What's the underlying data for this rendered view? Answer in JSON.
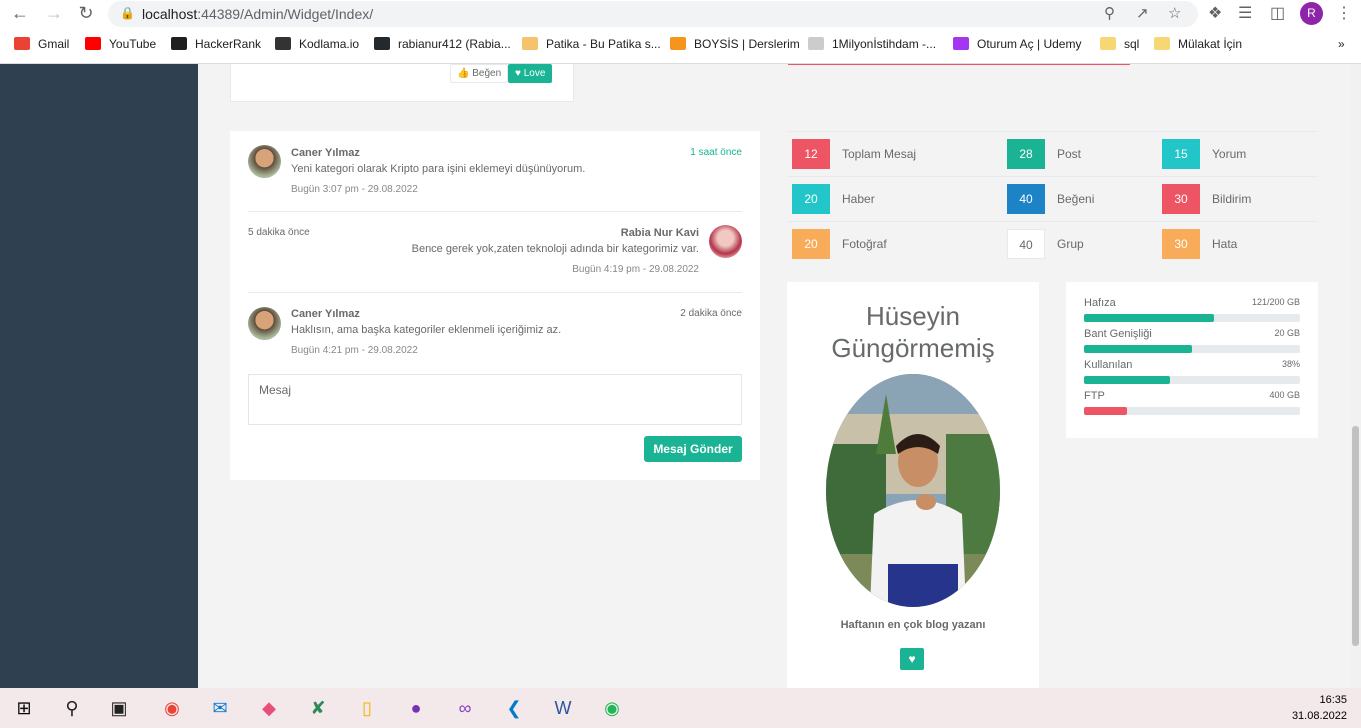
{
  "browser": {
    "url_host": "localhost",
    "url_path": ":44389/Admin/Widget/Index/",
    "profile_initial": "R",
    "bookmarks": [
      {
        "label": "Gmail",
        "color": "#ea4335"
      },
      {
        "label": "YouTube",
        "color": "#ff0000"
      },
      {
        "label": "HackerRank",
        "color": "#1f1f1f"
      },
      {
        "label": "Kodlama.io",
        "color": "#333333"
      },
      {
        "label": "rabianur412 (Rabia...",
        "color": "#24292e"
      },
      {
        "label": "Patika - Bu Patika s...",
        "color": "#f6c26b"
      },
      {
        "label": "BOYSİS | Derslerim",
        "color": "#f7941d"
      },
      {
        "label": "1Milyonİstihdam -...",
        "color": "#cccccc"
      },
      {
        "label": "Oturum Aç | Udemy",
        "color": "#a435f0"
      },
      {
        "label": "sql",
        "color": "#f7d774"
      },
      {
        "label": "Mülakat İçin",
        "color": "#f7d774"
      }
    ]
  },
  "top_widget": {
    "like_label": "Beğen",
    "love_label": "Love"
  },
  "chat": {
    "messages": [
      {
        "name": "Caner Yılmaz",
        "text": "Yeni kategori olarak Kripto para işini eklemeyi düşünüyorum.",
        "date": "Bugün 3:07 pm - 29.08.2022",
        "ago": "1 saat önce"
      },
      {
        "name": "Rabia Nur Kavi",
        "text": "Bence gerek yok,zaten teknoloji adında bir kategorimiz var.",
        "date": "Bugün 4:19 pm - 29.08.2022",
        "ago": "5 dakika önce"
      },
      {
        "name": "Caner Yılmaz",
        "text": "Haklısın, ama başka kategoriler eklenmeli içeriğimiz az.",
        "date": "Bugün 4:21 pm - 29.08.2022",
        "ago": "2 dakika önce"
      }
    ],
    "input_placeholder": "Mesaj",
    "send_label": "Mesaj Gönder"
  },
  "stats": [
    {
      "value": "12",
      "label": "Toplam Mesaj",
      "color": "#ed5565"
    },
    {
      "value": "28",
      "label": "Post",
      "color": "#1ab394"
    },
    {
      "value": "15",
      "label": "Yorum",
      "color": "#23c6c8"
    },
    {
      "value": "20",
      "label": "Haber",
      "color": "#23c6c8"
    },
    {
      "value": "40",
      "label": "Beğeni",
      "color": "#1c84c6"
    },
    {
      "value": "30",
      "label": "Bildirim",
      "color": "#ed5565"
    },
    {
      "value": "20",
      "label": "Fotoğraf",
      "color": "#f8ac59"
    },
    {
      "value": "40",
      "label": "Grup",
      "color": "#ffffff"
    },
    {
      "value": "30",
      "label": "Hata",
      "color": "#f8ac59"
    }
  ],
  "profile": {
    "first_name": "Hüseyin",
    "last_name": "Güngörmemiş",
    "caption": "Haftanın en çok blog yazanı"
  },
  "storage": [
    {
      "label": "Hafıza",
      "value": "121/200 GB",
      "percent": 60,
      "color": "#1ab394"
    },
    {
      "label": "Bant Genişliği",
      "value": "20 GB",
      "percent": 50,
      "color": "#1ab394"
    },
    {
      "label": "Kullanılan",
      "value": "38%",
      "percent": 40,
      "color": "#1ab394"
    },
    {
      "label": "FTP",
      "value": "400 GB",
      "percent": 20,
      "color": "#ed5565"
    }
  ],
  "taskbar": {
    "time": "16:35",
    "date": "31.08.2022"
  }
}
